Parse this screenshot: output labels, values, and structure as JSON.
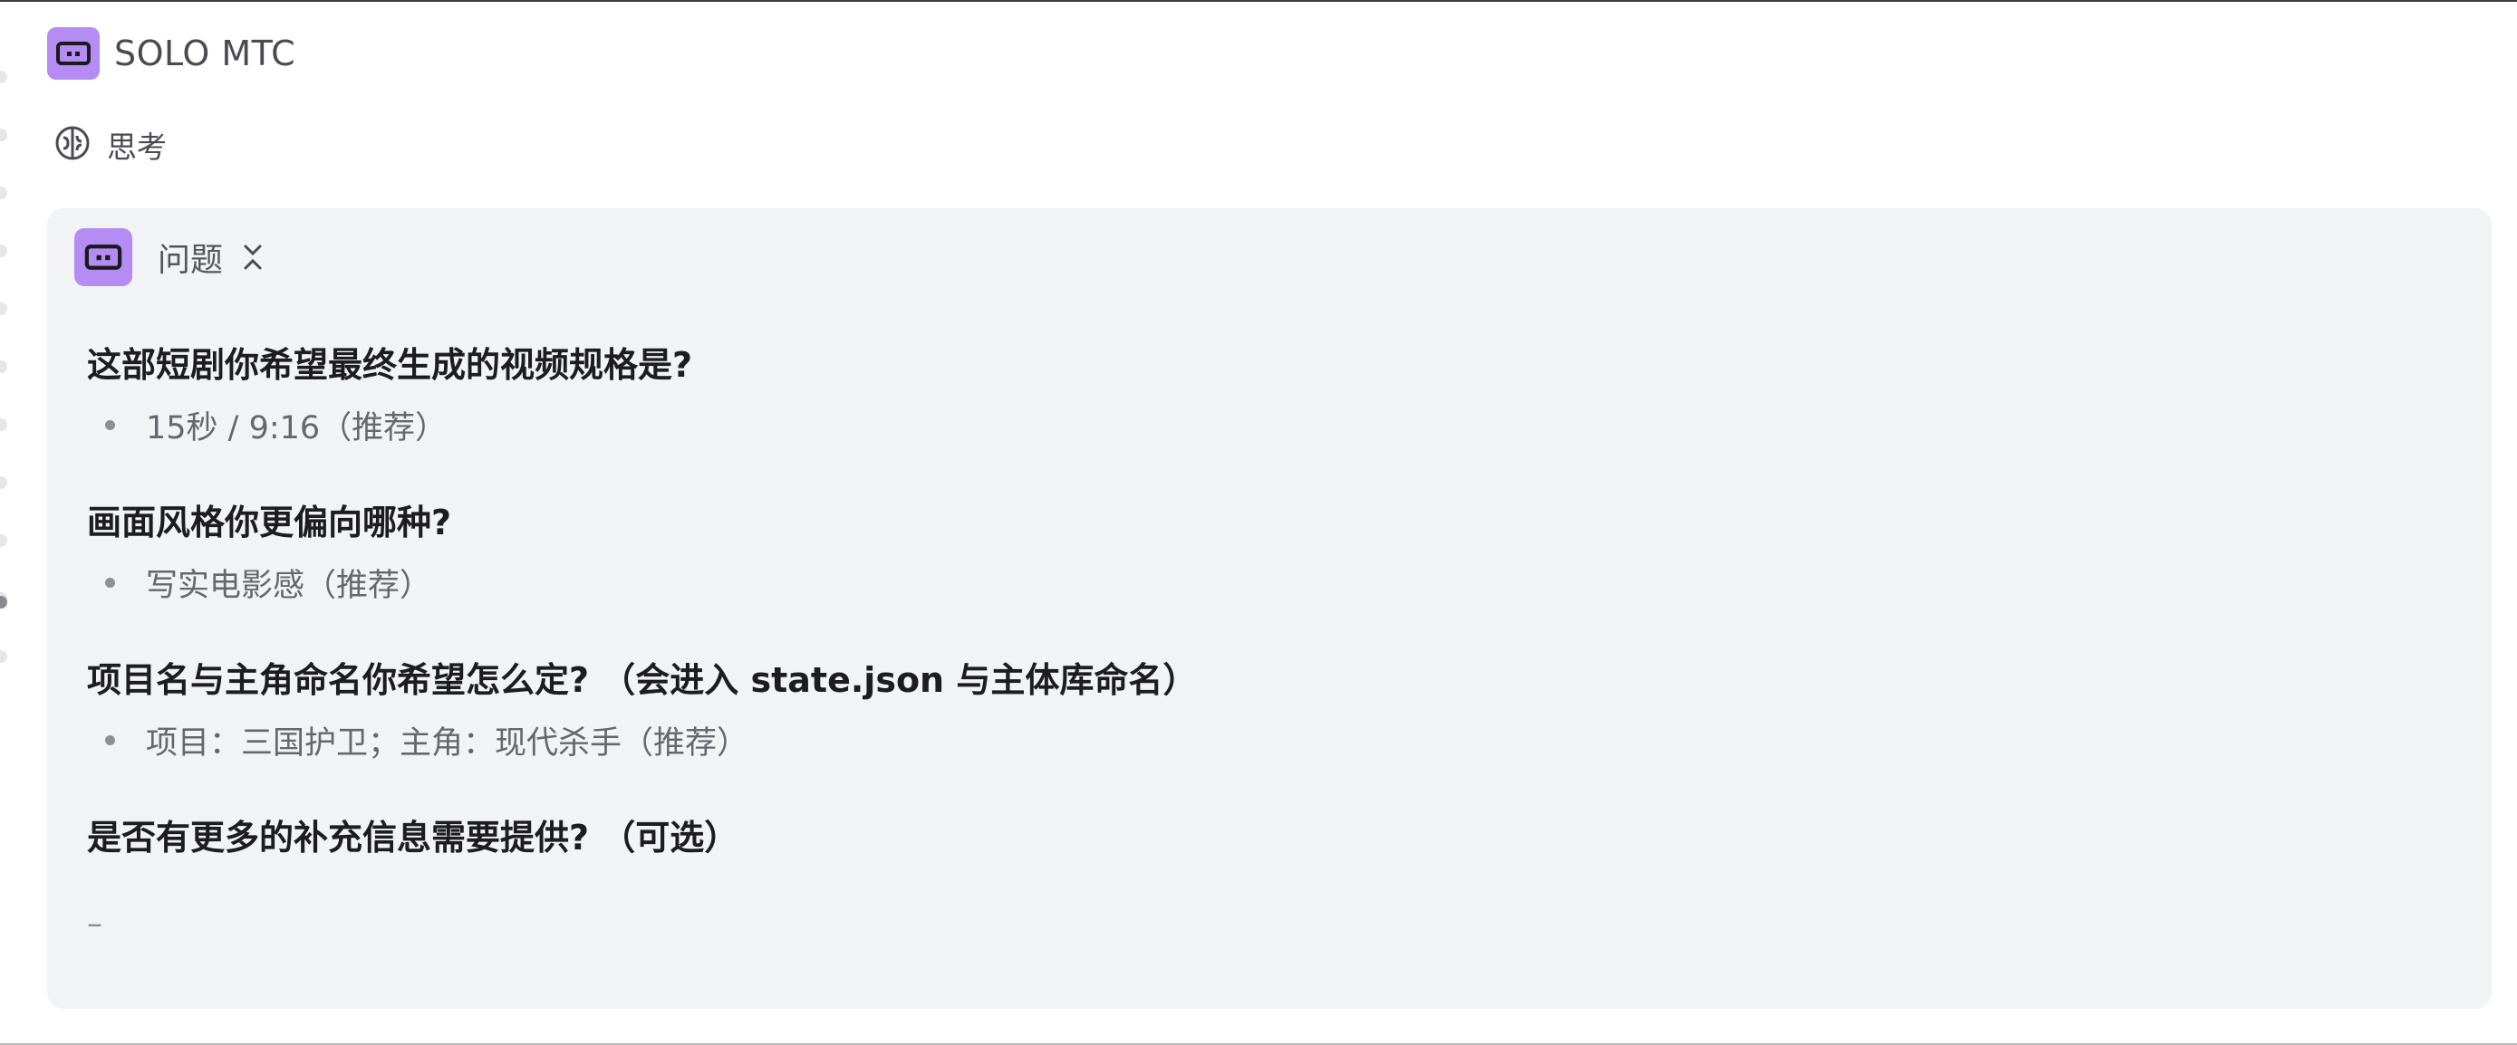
{
  "header": {
    "title": "SOLO MTC",
    "icon": "robot-face-icon",
    "icon_color": "#b58cf4"
  },
  "thinking": {
    "label": "思考",
    "icon": "brain-icon"
  },
  "card": {
    "title": "问题",
    "icon": "robot-face-icon",
    "collapse_icon": "collapse-chevrons-icon",
    "background": "#f2f3f5",
    "questions": [
      {
        "question": "这部短剧你希望最终生成的视频规格是?",
        "answer": "15秒 / 9:16（推荐）"
      },
      {
        "question": "画面风格你更偏向哪种?",
        "answer": "写实电影感（推荐）"
      },
      {
        "question": "项目名与主角命名你希望怎么定? （会进入 state.json 与主体库命名）",
        "answer": "项目：三国护卫；主角：现代杀手（推荐）"
      },
      {
        "question": "是否有更多的补充信息需要提供? （可选）",
        "answer": "–"
      }
    ]
  }
}
